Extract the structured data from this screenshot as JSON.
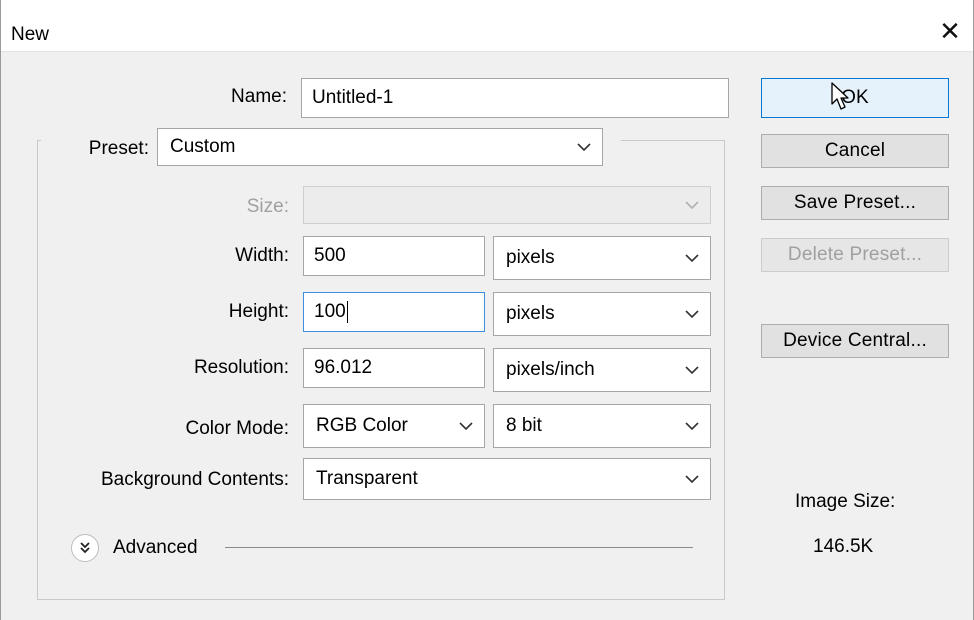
{
  "window": {
    "title": "New",
    "close_glyph": "✕"
  },
  "form": {
    "name": {
      "label": "Name:",
      "value": "Untitled-1"
    },
    "preset": {
      "label": "Preset:",
      "value": "Custom"
    },
    "size": {
      "label": "Size:",
      "value": ""
    },
    "width": {
      "label": "Width:",
      "value": "500",
      "unit": "pixels"
    },
    "height": {
      "label": "Height:",
      "value": "100",
      "unit": "pixels"
    },
    "resolution": {
      "label": "Resolution:",
      "value": "96.012",
      "unit": "pixels/inch"
    },
    "color_mode": {
      "label": "Color Mode:",
      "value": "RGB Color",
      "depth": "8 bit"
    },
    "background": {
      "label": "Background Contents:",
      "value": "Transparent"
    },
    "advanced": {
      "label": "Advanced"
    }
  },
  "buttons": {
    "ok": "OK",
    "cancel": "Cancel",
    "save_preset": "Save Preset...",
    "delete_preset": "Delete Preset...",
    "device_central": "Device Central..."
  },
  "image_size": {
    "label": "Image Size:",
    "value": "146.5K"
  },
  "icons": {
    "close": "close-icon",
    "dropdown": "chevron-down-icon",
    "advanced": "double-chevron-down-icon",
    "cursor": "mouse-pointer-icon"
  },
  "colors": {
    "default_button_border": "#0078d7",
    "focus_border": "#3c8fd8"
  }
}
